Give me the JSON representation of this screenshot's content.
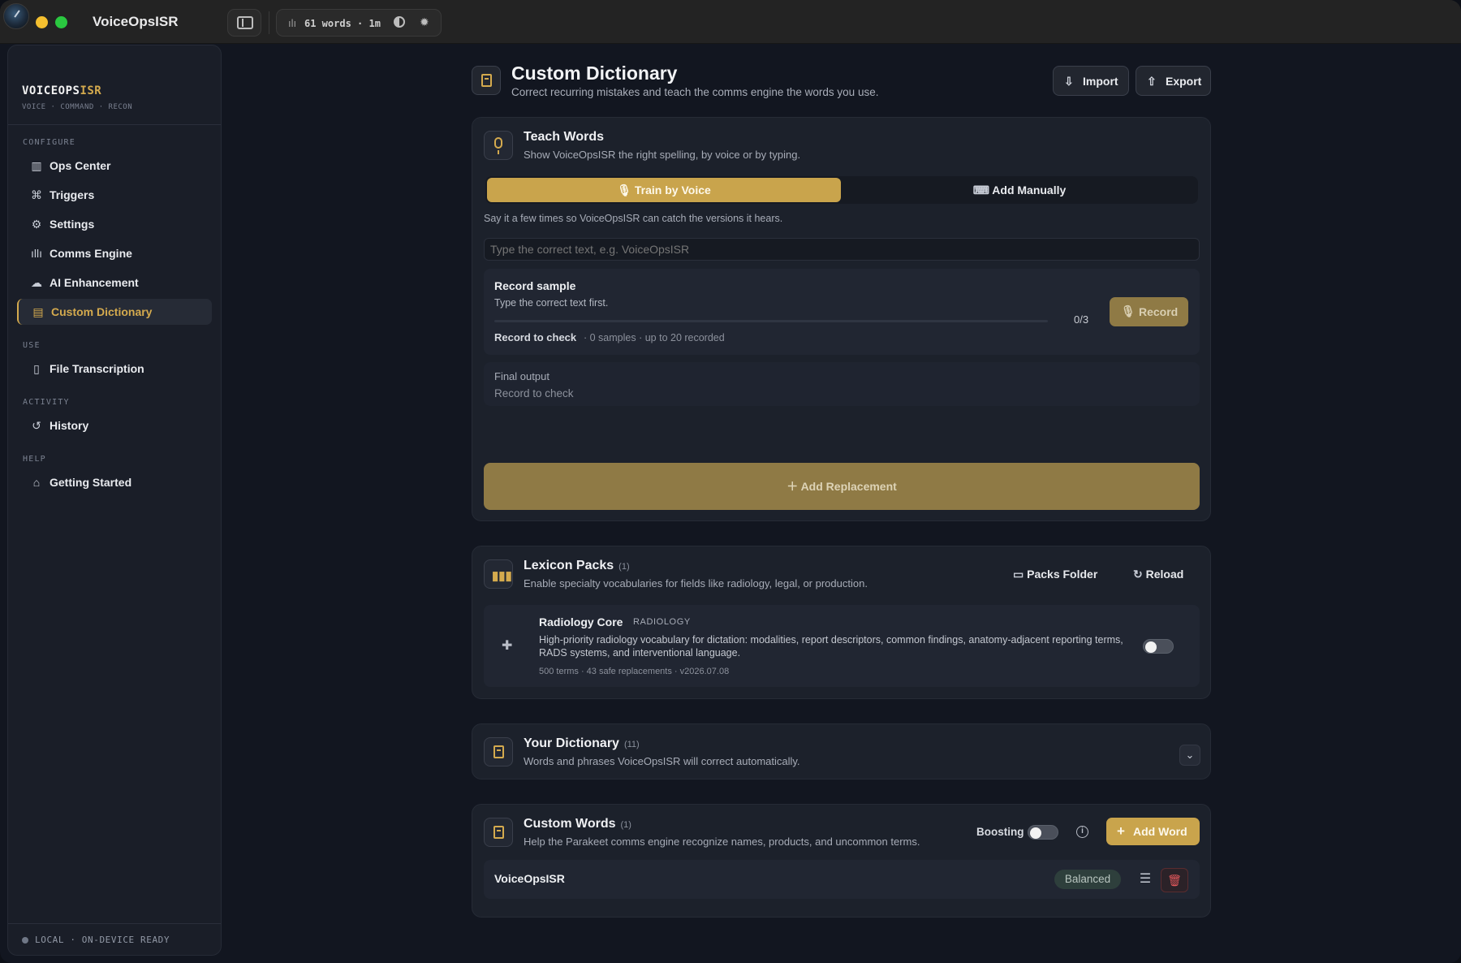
{
  "app": {
    "title": "VoiceOpsISR"
  },
  "toolbar": {
    "stats": "61 words · 1m"
  },
  "sidebar": {
    "brand_main": "VOICEOPS",
    "brand_accent": "ISR",
    "brand_sub": "VOICE · COMMAND · RECON",
    "sections": {
      "configure": "CONFIGURE",
      "use": "USE",
      "activity": "ACTIVITY",
      "help": "HELP"
    },
    "items": {
      "ops_center": "Ops Center",
      "triggers": "Triggers",
      "settings": "Settings",
      "comms_engine": "Comms Engine",
      "ai_enhancement": "AI Enhancement",
      "custom_dictionary": "Custom Dictionary",
      "file_transcription": "File Transcription",
      "history": "History",
      "getting_started": "Getting Started"
    },
    "footer": "LOCAL · ON-DEVICE READY"
  },
  "header": {
    "title": "Custom Dictionary",
    "subtitle": "Correct recurring mistakes and teach the comms engine the words you use.",
    "import_label": "Import",
    "export_label": "Export"
  },
  "teach": {
    "title": "Teach Words",
    "subtitle": "Show VoiceOpsISR the right spelling, by voice or by typing.",
    "tab_voice": "Train by Voice",
    "tab_manual": "Add Manually",
    "hint": "Say it a few times so VoiceOpsISR can catch the versions it hears.",
    "input_placeholder": "Type the correct text, e.g. VoiceOpsISR",
    "record_title": "Record sample",
    "record_sub": "Type the correct text first.",
    "record_count": "0/3",
    "record_button": "Record",
    "record_check": "Record to check",
    "record_meta": "· 0 samples · up to 20 recorded",
    "final_label": "Final output",
    "final_value": "Record to check",
    "add_replacement": "Add Replacement"
  },
  "lexicon": {
    "title": "Lexicon Packs",
    "count": "(1)",
    "subtitle": "Enable specialty vocabularies for fields like radiology, legal, or production.",
    "folder_label": "Packs Folder",
    "reload_label": "Reload",
    "pack": {
      "name": "Radiology Core",
      "tag": "RADIOLOGY",
      "description": "High-priority radiology vocabulary for dictation: modalities, report descriptors, common findings, anatomy-adjacent reporting terms, RADS systems, and interventional language.",
      "meta": "500 terms · 43 safe replacements · v2026.07.08",
      "enabled": false
    }
  },
  "your_dictionary": {
    "title": "Your Dictionary",
    "count": "(11)",
    "subtitle": "Words and phrases VoiceOpsISR will correct automatically."
  },
  "custom_words": {
    "title": "Custom Words",
    "count": "(1)",
    "subtitle": "Help the Parakeet comms engine recognize names, products, and uncommon terms.",
    "boosting_label": "Boosting",
    "boosting_enabled": false,
    "add_label": "Add Word",
    "words": [
      {
        "word": "VoiceOpsISR",
        "level": "Balanced"
      }
    ]
  },
  "colors": {
    "accent": "#d4aa4e",
    "accent_button": "#c9a44c",
    "background": "#121620",
    "card": "#1c212b"
  }
}
